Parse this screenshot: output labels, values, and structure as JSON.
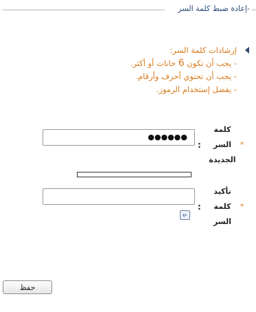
{
  "section": {
    "legend": "-إعادة ضبط كلمة السر"
  },
  "instructions": {
    "heading": "إرشادات كلمة السر:",
    "rule1_prefix": "- يجب أن تكون ",
    "rule1_number": "6",
    "rule1_suffix": " خانات أو أكثر.",
    "rule2": "- يجب أن تحتوي أحرف وأرقام.",
    "rule3": "- يفضل إستخدام الرموز."
  },
  "fields": {
    "new_password": {
      "label_line1": "كلمة",
      "label_line2": "السر",
      "label_line3": "الجديدة",
      "required_mark": "*",
      "colon": ":",
      "masked_value": "●●●●●●"
    },
    "confirm_password": {
      "label_line1": "تأكيد",
      "label_line2": "كلمة",
      "label_line3": "السر",
      "required_mark": "*",
      "colon": ":",
      "value": ""
    }
  },
  "strength_meter": {
    "level": 0
  },
  "keyboard_icon": {
    "text": "عع"
  },
  "buttons": {
    "save": "حفظ"
  },
  "colors": {
    "instruction_text": "#d87a1c",
    "legend_text": "#2a4a78",
    "required_star": "#e07a1a"
  }
}
